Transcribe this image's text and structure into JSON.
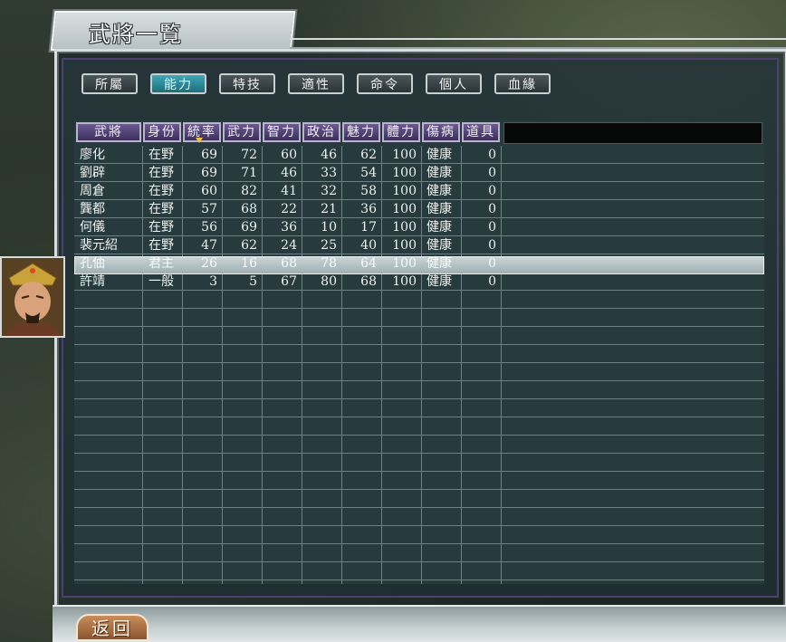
{
  "window": {
    "title": "武將一覧"
  },
  "tabs": [
    {
      "label": "所屬",
      "active": false
    },
    {
      "label": "能力",
      "active": true
    },
    {
      "label": "特技",
      "active": false
    },
    {
      "label": "適性",
      "active": false
    },
    {
      "label": "命令",
      "active": false
    },
    {
      "label": "個人",
      "active": false
    },
    {
      "label": "血緣",
      "active": false
    }
  ],
  "table": {
    "columns": [
      "武將",
      "身份",
      "統率",
      "武力",
      "智力",
      "政治",
      "魅力",
      "體力",
      "傷病",
      "道具"
    ],
    "sorted_column": "統率",
    "selected_row": 6,
    "rows": [
      {
        "name": "廖化",
        "status": "在野",
        "lead": "69",
        "war": "72",
        "int": "60",
        "pol": "46",
        "chr": "62",
        "hp": "100",
        "health": "健康",
        "items": "0"
      },
      {
        "name": "劉辟",
        "status": "在野",
        "lead": "69",
        "war": "71",
        "int": "46",
        "pol": "33",
        "chr": "54",
        "hp": "100",
        "health": "健康",
        "items": "0"
      },
      {
        "name": "周倉",
        "status": "在野",
        "lead": "60",
        "war": "82",
        "int": "41",
        "pol": "32",
        "chr": "58",
        "hp": "100",
        "health": "健康",
        "items": "0"
      },
      {
        "name": "龔都",
        "status": "在野",
        "lead": "57",
        "war": "68",
        "int": "22",
        "pol": "21",
        "chr": "36",
        "hp": "100",
        "health": "健康",
        "items": "0"
      },
      {
        "name": "何儀",
        "status": "在野",
        "lead": "56",
        "war": "69",
        "int": "36",
        "pol": "10",
        "chr": "17",
        "hp": "100",
        "health": "健康",
        "items": "0"
      },
      {
        "name": "裴元紹",
        "status": "在野",
        "lead": "47",
        "war": "62",
        "int": "24",
        "pol": "25",
        "chr": "40",
        "hp": "100",
        "health": "健康",
        "items": "0"
      },
      {
        "name": "孔伷",
        "status": "君主",
        "lead": "26",
        "war": "16",
        "int": "68",
        "pol": "78",
        "chr": "64",
        "hp": "100",
        "health": "健康",
        "items": "0"
      },
      {
        "name": "許靖",
        "status": "一般",
        "lead": "3",
        "war": "5",
        "int": "67",
        "pol": "80",
        "chr": "68",
        "hp": "100",
        "health": "健康",
        "items": "0"
      }
    ]
  },
  "portrait": {
    "icon": "general-portrait-icon"
  },
  "footer": {
    "back_label": "返回"
  },
  "colors": {
    "tab_active": "#2a8b9a",
    "header_purple": "#4f3f72",
    "selected_row": "#b7c4c6",
    "sort_marker": "#f2c33b"
  }
}
